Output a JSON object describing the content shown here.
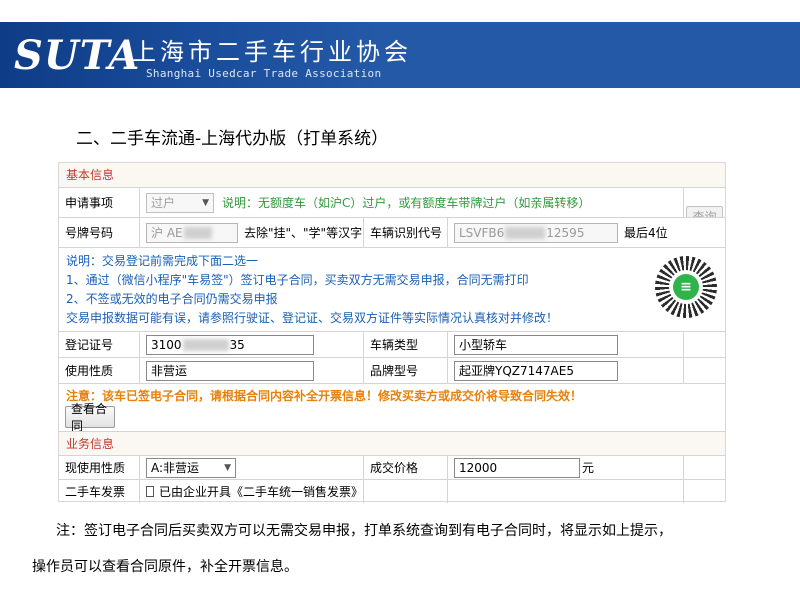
{
  "header": {
    "logo": "SUTA",
    "org_name_cn": "上海市二手车行业协会",
    "org_name_en": "Shanghai Usedcar Trade Association"
  },
  "section_title": "二、二手车流通-上海代办版（打单系统）",
  "basic_info": {
    "header": "基本信息",
    "apply_item": {
      "label": "申请事项",
      "value": "过户",
      "note": "说明：无额度车（如沪C）过户，或有额度车带牌过户（如亲属转移）"
    },
    "plate": {
      "label": "号牌号码",
      "value_prefix": "沪 AE",
      "hint": "去除\"挂\"、\"学\"等汉字"
    },
    "vin": {
      "label": "车辆识别代号",
      "value_prefix": "LSVFB6",
      "value_suffix": "12595",
      "hint": "最后4位"
    },
    "query_button": "查询",
    "notice": {
      "line1": "说明：交易登记前需完成下面二选一",
      "line2": "1、通过（微信小程序\"车易签\"）签订电子合同，买卖双方无需交易申报，合同无需打印",
      "line3": "2、不签或无效的电子合同仍需交易申报",
      "line4": "交易申报数据可能有误，请参照行驶证、登记证、交易双方证件等实际情况认真核对并修改！"
    },
    "reg_cert": {
      "label": "登记证号",
      "value_prefix": "3100",
      "value_suffix": "35"
    },
    "vehicle_type": {
      "label": "车辆类型",
      "value": "小型轿车"
    },
    "usage": {
      "label": "使用性质",
      "value": "非营运"
    },
    "brand_model": {
      "label": "品牌型号",
      "value": "起亚牌YQZ7147AE5"
    },
    "warning": "注意：该车已签电子合同，请根据合同内容补全开票信息！修改买卖方或成交价将导致合同失效！",
    "view_contract_button": "查看合同"
  },
  "business_info": {
    "header": "业务信息",
    "current_usage": {
      "label": "现使用性质",
      "value": "A:非营运"
    },
    "price": {
      "label": "成交价格",
      "value": "12000",
      "unit": "元"
    },
    "invoice": {
      "label": "二手车发票",
      "checkbox_label": "已由企业开具《二手车统一销售发票》"
    }
  },
  "footnote": {
    "line1": "注：签订电子合同后买卖双方可以无需交易申报，打单系统查询到有电子合同时，将显示如上提示，",
    "line2": "操作员可以查看合同原件，补全开票信息。"
  },
  "colors": {
    "banner": "#2459a8",
    "section_header_text": "#c0392b",
    "note_green": "#2f9a3b",
    "note_blue": "#1a5fb4",
    "warning_orange": "#e8810b",
    "qr_logo": "#2fb34a"
  },
  "icons": [
    "dropdown-chevron-icon",
    "qr-code-icon",
    "checkbox-icon"
  ]
}
